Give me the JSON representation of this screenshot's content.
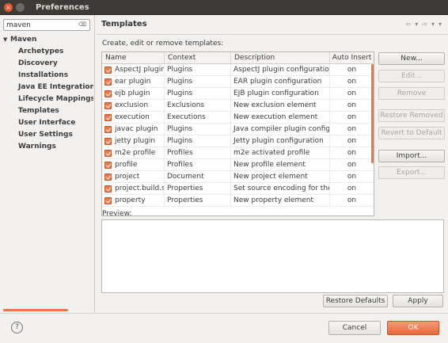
{
  "window": {
    "title": "Preferences",
    "close_glyph": "×"
  },
  "filter": {
    "value": "maven",
    "clear_glyph": "⌫"
  },
  "tree": {
    "root": {
      "label": "Maven",
      "arrow": "▼"
    },
    "children": [
      {
        "label": "Archetypes"
      },
      {
        "label": "Discovery"
      },
      {
        "label": "Installations"
      },
      {
        "label": "Java EE Integration"
      },
      {
        "label": "Lifecycle Mappings"
      },
      {
        "label": "Templates",
        "selected": true
      },
      {
        "label": "User Interface"
      },
      {
        "label": "User Settings"
      },
      {
        "label": "Warnings"
      }
    ]
  },
  "page": {
    "title": "Templates",
    "description": "Create, edit or remove templates:",
    "nav_icons": {
      "back": "⇦",
      "back_menu": "▾",
      "forward": "⇨",
      "forward_menu": "▾",
      "view_menu": "▾"
    }
  },
  "table": {
    "columns": [
      "Name",
      "Context",
      "Description",
      "Auto Insert"
    ],
    "rows": [
      {
        "name": "AspectJ plugin",
        "context": "Plugins",
        "description": "AspectJ plugin configuration",
        "auto": "on",
        "checked": true
      },
      {
        "name": "ear plugin",
        "context": "Plugins",
        "description": "EAR plugin configuration",
        "auto": "on",
        "checked": true
      },
      {
        "name": "ejb plugin",
        "context": "Plugins",
        "description": "EJB plugin configuration",
        "auto": "on",
        "checked": true
      },
      {
        "name": "exclusion",
        "context": "Exclusions",
        "description": "New exclusion element",
        "auto": "on",
        "checked": true
      },
      {
        "name": "execution",
        "context": "Executions",
        "description": "New execution element",
        "auto": "on",
        "checked": true
      },
      {
        "name": "javac plugin",
        "context": "Plugins",
        "description": "Java compiler plugin configuration",
        "auto": "on",
        "checked": true
      },
      {
        "name": "jetty plugin",
        "context": "Plugins",
        "description": "Jetty plugin configuration",
        "auto": "on",
        "checked": true
      },
      {
        "name": "m2e profile",
        "context": "Profiles",
        "description": "m2e activated profile",
        "auto": "on",
        "checked": true
      },
      {
        "name": "profile",
        "context": "Profiles",
        "description": "New profile element",
        "auto": "on",
        "checked": true
      },
      {
        "name": "project",
        "context": "Document",
        "description": "New project element",
        "auto": "on",
        "checked": true
      },
      {
        "name": "project.build.s",
        "context": "Properties",
        "description": "Set source encoding for the",
        "auto": "on",
        "checked": true
      },
      {
        "name": "property",
        "context": "Properties",
        "description": "New property element",
        "auto": "on",
        "checked": true
      }
    ]
  },
  "buttons": {
    "new": "New...",
    "edit": "Edit...",
    "remove": "Remove",
    "restore_removed": "Restore Removed",
    "revert_default": "Revert to Default",
    "import": "Import...",
    "export": "Export...",
    "restore_defaults": "Restore Defaults",
    "apply": "Apply",
    "cancel": "Cancel",
    "ok": "OK"
  },
  "preview": {
    "label": "Preview:"
  },
  "help": {
    "glyph": "?"
  },
  "colors": {
    "accent": "#f07746",
    "titlebar": "#3c3b37",
    "background": "#f2f1f0"
  }
}
